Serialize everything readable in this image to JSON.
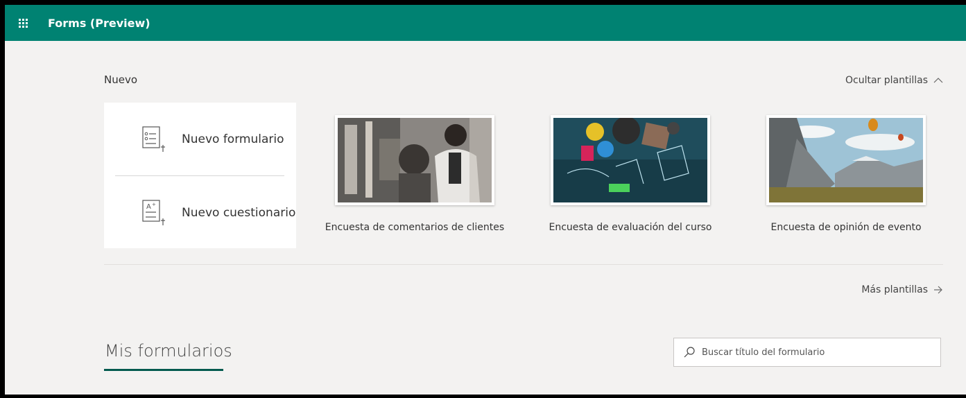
{
  "app": {
    "title": "Forms (Preview)"
  },
  "new_section": {
    "label": "Nuevo",
    "hide_templates": "Ocultar plantillas",
    "new_form": "Nuevo formulario",
    "new_quiz": "Nuevo cuestionario"
  },
  "templates": [
    {
      "caption": "Encuesta de comentarios de clientes"
    },
    {
      "caption": "Encuesta de evaluación del curso"
    },
    {
      "caption": "Encuesta de opinión de evento"
    }
  ],
  "more_templates": "Más plantillas",
  "my_forms": {
    "title": "Mis formularios",
    "search_placeholder": "Buscar título del formulario"
  },
  "colors": {
    "brand": "#008272",
    "accent_dark": "#005a4e",
    "background": "#f3f2f1"
  }
}
